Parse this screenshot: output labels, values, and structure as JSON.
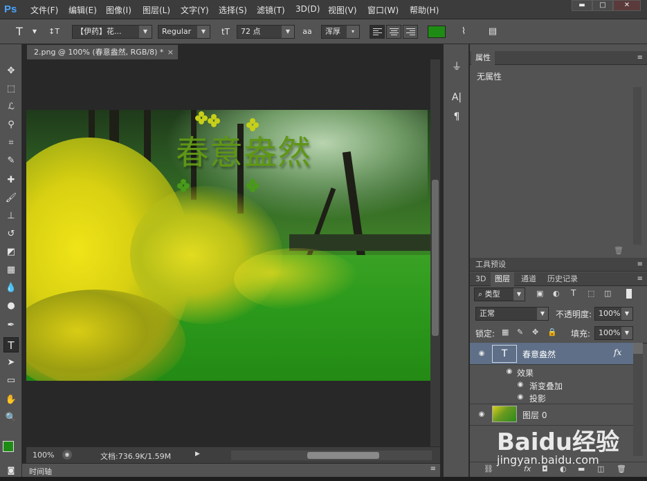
{
  "app": {
    "logo": "Ps"
  },
  "menu": [
    "文件(F)",
    "编辑(E)",
    "图像(I)",
    "图层(L)",
    "文字(Y)",
    "选择(S)",
    "滤镜(T)",
    "3D(D)",
    "视图(V)",
    "窗口(W)",
    "帮助(H)"
  ],
  "window_buttons": {
    "minimize": "▬",
    "maximize": "□",
    "close": "✕"
  },
  "options_bar": {
    "text_tool_icon": "T",
    "orient_icon": "↕T",
    "font_family": "【伊药】花...",
    "font_style": "Regular",
    "size_icon": "tT",
    "font_size": "72 点",
    "aa_icon": "aa",
    "antialias": "浑厚",
    "text_color": "#1e8c14"
  },
  "document": {
    "tab_title": "2.png @ 100% (春意盎然, RGB/8) *",
    "close": "×",
    "zoom": "100%",
    "doc_info": "文档:736.9K/1.59M",
    "photo_text": "春意盎然"
  },
  "timeline_label": "时间轴",
  "properties_panel": {
    "title": "属性",
    "content": "无属性"
  },
  "tool_presets": {
    "title": "工具预设"
  },
  "layers_panel": {
    "tabs": [
      "3D",
      "图层",
      "通道",
      "历史记录"
    ],
    "active_tab": "图层",
    "filter_kind": "类型",
    "blend_mode": "正常",
    "opacity_label": "不透明度:",
    "opacity": "100%",
    "lock_label": "锁定:",
    "fill_label": "填充:",
    "fill": "100%",
    "layers": [
      {
        "name": "春意盎然",
        "type": "text",
        "fx": "fx",
        "effects_label": "效果",
        "effects": [
          "渐变叠加",
          "投影"
        ]
      },
      {
        "name": "图层 0",
        "type": "image"
      }
    ]
  },
  "watermark": {
    "logo": "Baidu经验",
    "url": "jingyan.baidu.com"
  }
}
